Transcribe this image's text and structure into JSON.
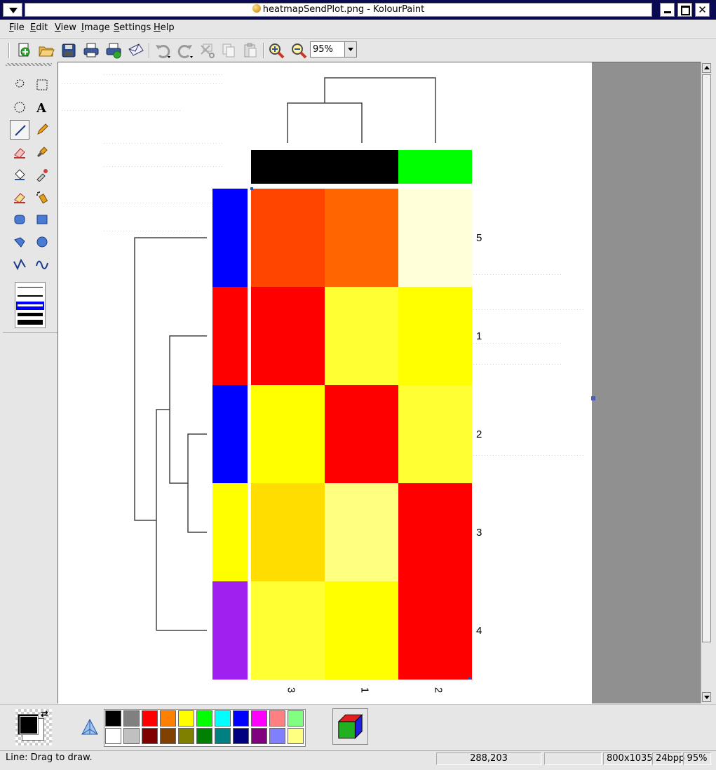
{
  "window": {
    "title": "heatmapSendPlot.png - KolourPaint",
    "close_glyph": "✕"
  },
  "menu": [
    {
      "key": "F",
      "rest": "ile"
    },
    {
      "key": "E",
      "rest": "dit"
    },
    {
      "key": "V",
      "rest": "iew"
    },
    {
      "key": "I",
      "rest": "mage"
    },
    {
      "key": "S",
      "rest": "ettings"
    },
    {
      "key": "H",
      "rest": "elp"
    }
  ],
  "toolbar": {
    "icons": [
      "new-icon",
      "open-icon",
      "save-icon",
      "print-icon",
      "print-preview-icon",
      "mail-icon",
      "undo-icon",
      "redo-icon",
      "cut-icon",
      "copy-icon",
      "paste-icon",
      "zoom-in-icon",
      "zoom-out-icon"
    ],
    "zoom_value": "95%"
  },
  "tools": [
    "free-form-selection",
    "rectangular-selection",
    "elliptical-selection",
    "text",
    "line",
    "pen",
    "eraser",
    "brush",
    "flood-fill",
    "color-picker",
    "color-eraser",
    "spraycan",
    "rounded-rectangle",
    "rectangle",
    "polygon",
    "ellipse",
    "connected-lines",
    "curve"
  ],
  "selected_tool": "line",
  "line_width_selected": 2,
  "heatmap": {
    "row_labels": [
      "5",
      "1",
      "2",
      "3",
      "4"
    ],
    "col_labels": [
      "3",
      "1",
      "2"
    ],
    "col_side_colors": [
      "#000000",
      "#000000",
      "#00ff00"
    ],
    "row_side_colors": [
      "#0000ff",
      "#ff0000",
      "#0000ff",
      "#ffff00",
      "#a020f0"
    ],
    "cells": [
      [
        "#ff4500",
        "#ff6600",
        "#ffffd9"
      ],
      [
        "#ff0000",
        "#ffff33",
        "#ffff00"
      ],
      [
        "#ffff00",
        "#ff0000",
        "#ffff33"
      ],
      [
        "#ffdd00",
        "#ffff80",
        "#ff0000"
      ],
      [
        "#ffff33",
        "#ffff00",
        "#ff0000"
      ]
    ]
  },
  "palette": [
    [
      "#000000",
      "#808080",
      "#ff0000",
      "#ff8000",
      "#ffff00",
      "#00ff00",
      "#00ffff",
      "#0000ff",
      "#ff00ff",
      "#ff8080",
      "#80ff80"
    ],
    [
      "#ffffff",
      "#c0c0c0",
      "#800000",
      "#804000",
      "#808000",
      "#008000",
      "#008080",
      "#000080",
      "#800080",
      "#8080ff",
      "#ffff80"
    ]
  ],
  "foreground_color": "#000000",
  "background_color": "#ffffff",
  "status": {
    "message": "Line: Drag to draw.",
    "cursor": "288,203",
    "selection": "",
    "size": "800x1035",
    "depth": "24bpp",
    "zoom": "95%"
  }
}
